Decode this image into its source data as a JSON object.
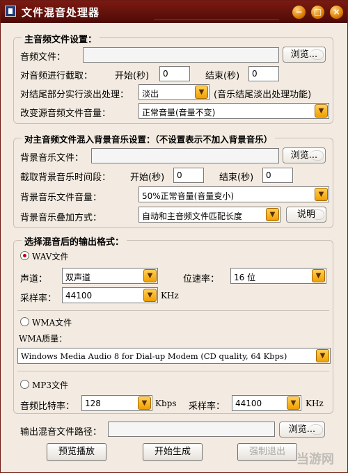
{
  "window": {
    "title": "文件混音处理器",
    "controls": {
      "minimize": "−",
      "maximize": "□",
      "close": "×"
    }
  },
  "section1": {
    "title": "主音频文件设置：",
    "audio_file_label": "音频文件：",
    "audio_file_value": "",
    "browse_label": "浏览...",
    "crop_label": "对音频进行截取：",
    "start_label": "开始(秒)",
    "start_value": "0",
    "end_label": "结束(秒)",
    "end_value": "0",
    "fade_label": "对结尾部分实行淡出处理：",
    "fade_value": "淡出",
    "fade_note": "(音乐结尾淡出处理功能)",
    "volume_label": "改变源音频文件音量：",
    "volume_value": "正常音量(音量不变)"
  },
  "section2": {
    "title": "对主音频文件混入背景音乐设置：（不设置表示不加入背景音乐）",
    "bg_file_label": "背景音乐文件：",
    "bg_file_value": "",
    "browse_label": "浏览...",
    "bg_time_label": "截取背景音乐时间段：",
    "start_label": "开始(秒)",
    "start_value": "0",
    "end_label": "结束(秒)",
    "end_value": "0",
    "bg_volume_label": "背景音乐文件音量：",
    "bg_volume_value": "50%正常音量(音量变小)",
    "bg_mode_label": "背景音乐叠加方式：",
    "bg_mode_value": "自动和主音频文件匹配长度",
    "explain_label": "说明"
  },
  "section3": {
    "title": "选择混音后的输出格式：",
    "wav": {
      "label": "WAV文件",
      "checked": true,
      "channel_label": "声道：",
      "channel_value": "双声道",
      "bitrate_label": "位速率：",
      "bitrate_value": "16 位",
      "samplerate_label": "采样率：",
      "samplerate_value": "44100",
      "samplerate_unit": "KHz"
    },
    "wma": {
      "label": "WMA文件",
      "checked": false,
      "quality_label": "WMA质量：",
      "quality_value": "Windows Media Audio 8 for Dial-up Modem (CD quality, 64 Kbps)"
    },
    "mp3": {
      "label": "MP3文件",
      "checked": false,
      "bitrate_label": "音频比特率：",
      "bitrate_value": "128",
      "bitrate_unit": "Kbps",
      "samplerate_label": "采样率：",
      "samplerate_value": "44100",
      "samplerate_unit": "KHz"
    }
  },
  "output": {
    "path_label": "输出混音文件路径：",
    "path_value": "",
    "browse_label": "浏览..."
  },
  "actions": {
    "preview": "预览播放",
    "start": "开始生成",
    "exit": "强制退出"
  },
  "watermark": "当游网"
}
